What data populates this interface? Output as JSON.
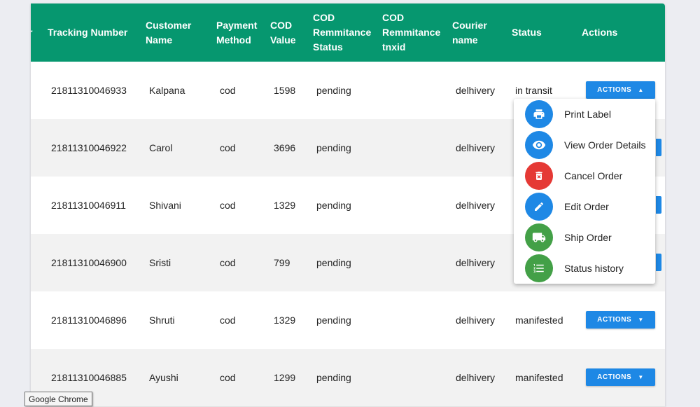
{
  "table": {
    "clipped_header": "r",
    "headers": [
      "Tracking Number",
      "Customer\nName",
      "Payment\nMethod",
      "COD\nValue",
      "COD\nRemmitance\nStatus",
      "COD\nRemmitance\ntnxid",
      "Courier\nname",
      "Status",
      "Actions"
    ],
    "rows": [
      {
        "tracking": "21811310046933",
        "customer": "Kalpana",
        "payment": "cod",
        "cod_value": "1598",
        "remit_status": "pending",
        "remit_txn": "",
        "courier": "delhivery",
        "status": "in transit",
        "actions_label": "ACTIONS",
        "open": true
      },
      {
        "tracking": "21811310046922",
        "customer": "Carol",
        "payment": "cod",
        "cod_value": "3696",
        "remit_status": "pending",
        "remit_txn": "",
        "courier": "delhivery",
        "status": "",
        "actions_label": "",
        "open": false
      },
      {
        "tracking": "21811310046911",
        "customer": "Shivani",
        "payment": "cod",
        "cod_value": "1329",
        "remit_status": "pending",
        "remit_txn": "",
        "courier": "delhivery",
        "status": "",
        "actions_label": "",
        "open": false
      },
      {
        "tracking": "21811310046900",
        "customer": "Sristi",
        "payment": "cod",
        "cod_value": "799",
        "remit_status": "pending",
        "remit_txn": "",
        "courier": "delhivery",
        "status": "",
        "actions_label": "",
        "open": false
      },
      {
        "tracking": "21811310046896",
        "customer": "Shruti",
        "payment": "cod",
        "cod_value": "1329",
        "remit_status": "pending",
        "remit_txn": "",
        "courier": "delhivery",
        "status": "manifested",
        "actions_label": "ACTIONS",
        "open": false
      },
      {
        "tracking": "21811310046885",
        "customer": "Ayushi",
        "payment": "cod",
        "cod_value": "1299",
        "remit_status": "pending",
        "remit_txn": "",
        "courier": "delhivery",
        "status": "manifested",
        "actions_label": "ACTIONS",
        "open": false
      }
    ]
  },
  "actions_menu": {
    "items": [
      {
        "label": "Print Label",
        "icon": "printer-icon",
        "color": "#1e88e5"
      },
      {
        "label": "View Order Details",
        "icon": "eye-icon",
        "color": "#1e88e5"
      },
      {
        "label": "Cancel Order",
        "icon": "trash-icon",
        "color": "#e53935"
      },
      {
        "label": "Edit Order",
        "icon": "pencil-icon",
        "color": "#1e88e5"
      },
      {
        "label": "Ship Order",
        "icon": "truck-icon",
        "color": "#43a047"
      },
      {
        "label": "Status history",
        "icon": "list-icon",
        "color": "#43a047"
      }
    ]
  },
  "tooltip": {
    "text": "Google Chrome"
  },
  "colors": {
    "header_bg": "#06976f",
    "button_bg": "#1e88e5",
    "danger": "#e53935",
    "success": "#43a047"
  }
}
